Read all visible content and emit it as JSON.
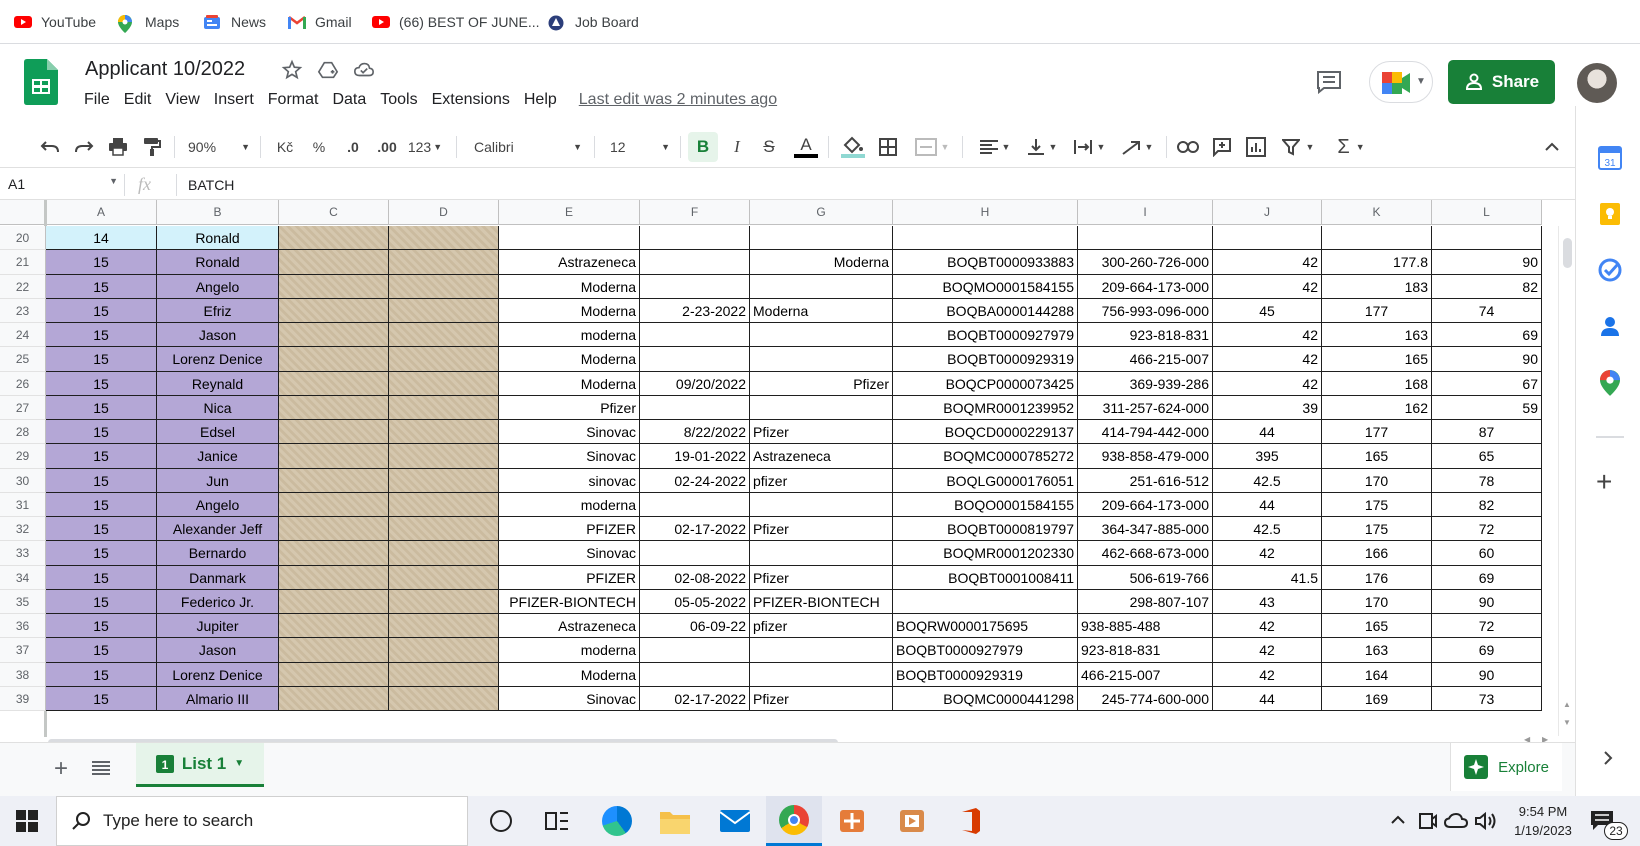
{
  "bookmarks": [
    {
      "label": "YouTube",
      "icon": "youtube-icon"
    },
    {
      "label": "Maps",
      "icon": "maps-icon"
    },
    {
      "label": "News",
      "icon": "news-icon"
    },
    {
      "label": "Gmail",
      "icon": "gmail-icon"
    },
    {
      "label": "(66) BEST OF JUNE...",
      "icon": "youtube-icon"
    },
    {
      "label": "Job Board",
      "icon": "job-board-icon"
    }
  ],
  "doc": {
    "title": "Applicant 10/2022",
    "last_edit": "Last edit was 2 minutes ago",
    "share_label": "Share",
    "menu": [
      "File",
      "Edit",
      "View",
      "Insert",
      "Format",
      "Data",
      "Tools",
      "Extensions",
      "Help"
    ]
  },
  "toolbar": {
    "zoom": "90%",
    "currency": "Kč",
    "percent": "%",
    "dec_decrease": ".0",
    "dec_increase": ".00",
    "format_more": "123",
    "font": "Calibri",
    "font_size": "12",
    "bold": "B",
    "italic": "I",
    "strike": "S",
    "text_color": "A"
  },
  "formula": {
    "cell_ref": "A1",
    "fx": "fx",
    "value": "BATCH"
  },
  "columns": [
    "A",
    "B",
    "C",
    "D",
    "E",
    "F",
    "G",
    "H",
    "I",
    "J",
    "K",
    "L"
  ],
  "rows": [
    {
      "n": "20",
      "A": "14",
      "B": "Ronald",
      "E": "",
      "F": "",
      "G": "",
      "H": "",
      "I": "",
      "J": "",
      "K": "",
      "L": ""
    },
    {
      "n": "21",
      "A": "15",
      "B": "Ronald",
      "E": "Astrazeneca",
      "F": "",
      "G": "Moderna",
      "H": "BOQBT0000933883",
      "I": "300-260-726-000",
      "J": "42",
      "K": "177.8",
      "L": "90"
    },
    {
      "n": "22",
      "A": "15",
      "B": "Angelo",
      "E": "Moderna",
      "F": "",
      "G": "",
      "H": "BOQMO0001584155",
      "I": "209-664-173-000",
      "J": "42",
      "K": "183",
      "L": "82"
    },
    {
      "n": "23",
      "A": "15",
      "B": "Efriz",
      "E": "Moderna",
      "F": "2-23-2022",
      "G": "Moderna",
      "H": "BOQBA0000144288",
      "I": "756-993-096-000",
      "J": "45",
      "K": "177",
      "L": "74"
    },
    {
      "n": "24",
      "A": "15",
      "B": "Jason",
      "E": "moderna",
      "F": "",
      "G": "",
      "H": "BOQBT0000927979",
      "I": "923-818-831",
      "J": "42",
      "K": "163",
      "L": "69"
    },
    {
      "n": "25",
      "A": "15",
      "B": "Lorenz Denice",
      "E": "Moderna",
      "F": "",
      "G": "",
      "H": "BOQBT0000929319",
      "I": "466-215-007",
      "J": "42",
      "K": "165",
      "L": "90"
    },
    {
      "n": "26",
      "A": "15",
      "B": "Reynald",
      "E": "Moderna",
      "F": "09/20/2022",
      "G": "Pfizer",
      "H": "BOQCP0000073425",
      "I": "369-939-286",
      "J": "42",
      "K": "168",
      "L": "67"
    },
    {
      "n": "27",
      "A": "15",
      "B": "Nica",
      "E": "Pfizer",
      "F": "",
      "G": "",
      "H": "BOQMR0001239952",
      "I": "311-257-624-000",
      "J": "39",
      "K": "162",
      "L": "59"
    },
    {
      "n": "28",
      "A": "15",
      "B": "Edsel",
      "E": "Sinovac",
      "F": "8/22/2022",
      "G": "Pfizer",
      "H": "BOQCD0000229137",
      "I": "414-794-442-000",
      "J": "44",
      "K": "177",
      "L": "87"
    },
    {
      "n": "29",
      "A": "15",
      "B": "Janice",
      "E": "Sinovac",
      "F": "19-01-2022",
      "G": "Astrazeneca",
      "H": "BOQMC0000785272",
      "I": "938-858-479-000",
      "J": "395",
      "K": "165",
      "L": "65"
    },
    {
      "n": "30",
      "A": "15",
      "B": "Jun",
      "E": "sinovac",
      "F": "02-24-2022",
      "G": "pfizer",
      "H": "BOQLG0000176051",
      "I": "251-616-512",
      "J": "42.5",
      "K": "170",
      "L": "78"
    },
    {
      "n": "31",
      "A": "15",
      "B": "Angelo",
      "E": "moderna",
      "F": "",
      "G": "",
      "H": "BOQO0001584155",
      "I": "209-664-173-000",
      "J": "44",
      "K": "175",
      "L": "82"
    },
    {
      "n": "32",
      "A": "15",
      "B": "Alexander Jeff",
      "E": "PFIZER",
      "F": "02-17-2022",
      "G": "Pfizer",
      "H": "BOQBT0000819797",
      "I": "364-347-885-000",
      "J": "42.5",
      "K": "175",
      "L": "72"
    },
    {
      "n": "33",
      "A": "15",
      "B": "Bernardo",
      "E": "Sinovac",
      "F": "",
      "G": "",
      "H": "BOQMR0001202330",
      "I": "462-668-673-000",
      "J": "42",
      "K": "166",
      "L": "60"
    },
    {
      "n": "34",
      "A": "15",
      "B": "Danmark",
      "E": "PFIZER",
      "F": "02-08-2022",
      "G": "Pfizer",
      "H": "BOQBT0001008411",
      "I": "506-619-766",
      "J": "41.5",
      "K": "176",
      "L": "69"
    },
    {
      "n": "35",
      "A": "15",
      "B": "Federico Jr.",
      "E": "PFIZER-BIONTECH",
      "F": "05-05-2022",
      "G": "PFIZER-BIONTECH",
      "H": "",
      "I": "298-807-107",
      "J": "43",
      "K": "170",
      "L": "90"
    },
    {
      "n": "36",
      "A": "15",
      "B": "Jupiter",
      "E": "Astrazeneca",
      "F": "06-09-22",
      "G": "pfizer",
      "H": "BOQRW0000175695",
      "I": "938-885-488",
      "J": "42",
      "K": "165",
      "L": "72"
    },
    {
      "n": "37",
      "A": "15",
      "B": "Jason",
      "E": "moderna",
      "F": "",
      "G": "",
      "H": "BOQBT0000927979",
      "I": "923-818-831",
      "J": "42",
      "K": "163",
      "L": "69"
    },
    {
      "n": "38",
      "A": "15",
      "B": "Lorenz Denice",
      "E": "Moderna",
      "F": "",
      "G": "",
      "H": "BOQBT0000929319",
      "I": "466-215-007",
      "J": "42",
      "K": "164",
      "L": "90"
    },
    {
      "n": "39",
      "A": "15",
      "B": "Almario III",
      "E": "Sinovac",
      "F": "02-17-2022",
      "G": "Pfizer",
      "H": "BOQMC0000441298",
      "I": "245-774-600-000",
      "J": "44",
      "K": "169",
      "L": "73"
    }
  ],
  "sheetbar": {
    "tab_label": "List 1",
    "explore_label": "Explore"
  },
  "taskbar": {
    "search_placeholder": "Type here to search",
    "time": "9:54 PM",
    "date": "1/19/2023",
    "notification_count": "23"
  },
  "colors": {
    "accent_green": "#188038",
    "selected_purple": "#b4a7d6",
    "highlight_blue": "#d3f2fb"
  }
}
